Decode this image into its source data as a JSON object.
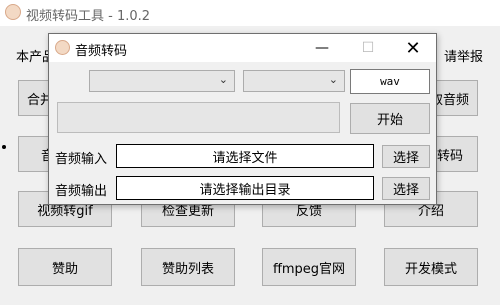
{
  "main_window": {
    "title": "视频转码工具 - 1.0.2",
    "notice_left": "本产品",
    "notice_right": "请举报",
    "buttons": {
      "merge": "合并",
      "extract_audio": "取音频",
      "left_partial": "音",
      "transcode": "转码",
      "video_to_gif": "视频转gif",
      "check_update": "检查更新",
      "feedback": "反馈",
      "intro": "介绍",
      "sponsor": "赞助",
      "sponsor_list": "赞助列表",
      "ffmpeg_site": "ffmpeg官网",
      "dev_mode": "开发模式"
    }
  },
  "dialog": {
    "title": "音频转码",
    "caption": {
      "minimize": "—",
      "maximize": "☐",
      "close": "✕"
    },
    "combo_a": {
      "value": "",
      "chevron": "⌄"
    },
    "combo_b": {
      "value": "",
      "chevron": "⌄"
    },
    "format_value": "wav",
    "progress": 0,
    "start_label": "开始",
    "input": {
      "label": "音频输入",
      "value": "请选择文件",
      "choose_label": "选择"
    },
    "output": {
      "label": "音频输出",
      "value": "请选择输出目录",
      "choose_label": "选择"
    }
  }
}
